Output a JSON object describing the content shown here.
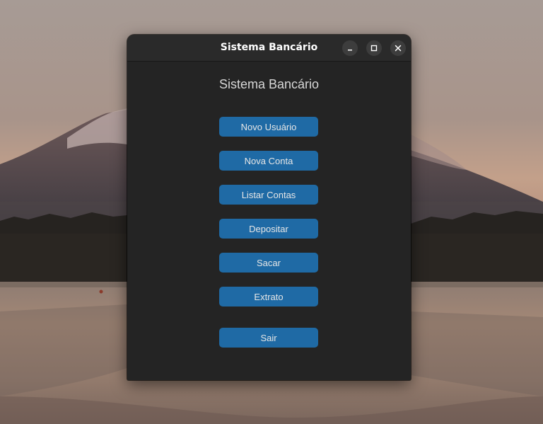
{
  "window": {
    "title": "Sistema Bancário",
    "controls": {
      "minimize_icon": "minimize-icon",
      "maximize_icon": "maximize-icon",
      "close_icon": "close-icon"
    }
  },
  "main": {
    "heading": "Sistema Bancário",
    "buttons": [
      {
        "label": "Novo Usuário"
      },
      {
        "label": "Nova Conta"
      },
      {
        "label": "Listar Contas"
      },
      {
        "label": "Depositar"
      },
      {
        "label": "Sacar"
      },
      {
        "label": "Extrato"
      },
      {
        "label": "Sair"
      }
    ]
  },
  "colors": {
    "button_bg": "#1f6aa5",
    "window_bg": "#242424",
    "titlebar_bg": "#2a2a2a"
  }
}
